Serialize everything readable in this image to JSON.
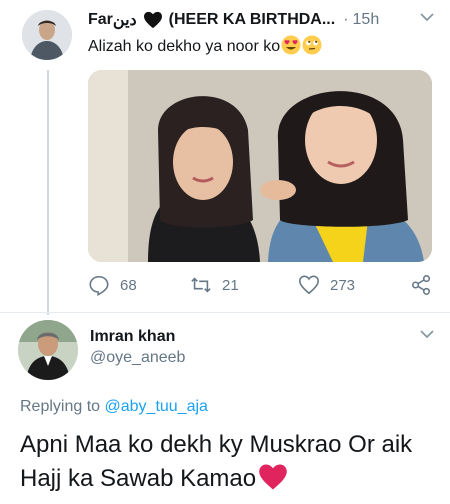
{
  "tweet": {
    "author_name": "Far",
    "author_name_urdu": "دین",
    "author_suffix": "(HEER KA BIRTHDA...",
    "separator": "·",
    "timestamp": "15h",
    "text": "Alizah ko dekho ya noor ko",
    "counts": {
      "replies": "68",
      "retweets": "21",
      "likes": "273"
    },
    "icons": [
      "heart-black-icon",
      "heart-eyes-emoji",
      "rolling-eyes-emoji",
      "reply-icon",
      "retweet-icon",
      "like-icon",
      "share-icon",
      "chevron-down-icon"
    ]
  },
  "reply": {
    "author_name": "Imran khan",
    "handle": "@oye_aneeb",
    "replying_prefix": "Replying to",
    "replying_to": "@aby_tuu_aja",
    "text": "Apni Maa ko dekh ky Muskrao Or aik Hajj ka Sawab Kamao"
  },
  "colors": {
    "accent": "#1da1f2",
    "muted": "#657786",
    "heart": "#e0245e"
  }
}
